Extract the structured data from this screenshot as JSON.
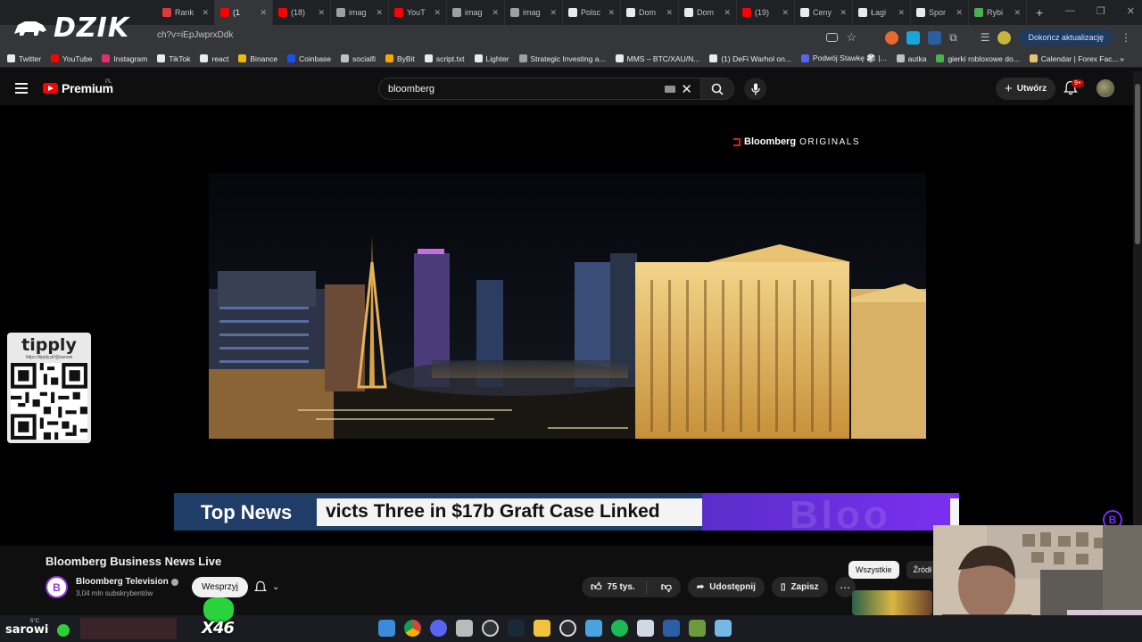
{
  "browser": {
    "tabs": [
      {
        "label": "Rank",
        "color": "#e03b3b"
      },
      {
        "label": "(1",
        "color": "#ff0000",
        "active": true
      },
      {
        "label": "(18)",
        "color": "#ff0000"
      },
      {
        "label": "imag",
        "color": "#9aa0a6"
      },
      {
        "label": "YouT",
        "color": "#ff0000"
      },
      {
        "label": "imag",
        "color": "#9aa0a6"
      },
      {
        "label": "imag",
        "color": "#9aa0a6"
      },
      {
        "label": "Polsc",
        "color": "#e8eaed"
      },
      {
        "label": "Dom",
        "color": "#e8eaed"
      },
      {
        "label": "Dom",
        "color": "#e8eaed"
      },
      {
        "label": "(19)",
        "color": "#ff0000"
      },
      {
        "label": "Ceny",
        "color": "#e8eaed"
      },
      {
        "label": "Łagi",
        "color": "#e8eaed"
      },
      {
        "label": "Spor",
        "color": "#e8eaed"
      },
      {
        "label": "Rybi",
        "color": "#4caf50"
      }
    ],
    "new_tab": "+",
    "url": "ch?v=iEpJwprxDdk",
    "update_button": "Dokończ aktualizację",
    "bookmarks": [
      {
        "label": "Twitter",
        "color": "#e8eaed"
      },
      {
        "label": "YouTube",
        "color": "#ff0000"
      },
      {
        "label": "Instagram",
        "color": "#e1306c"
      },
      {
        "label": "TikTok",
        "color": "#e8eaed"
      },
      {
        "label": "react",
        "color": "#e8eaed"
      },
      {
        "label": "Binance",
        "color": "#f0b90b"
      },
      {
        "label": "Coinbase",
        "color": "#1652f0"
      },
      {
        "label": "socialfi",
        "color": "#bdc1c6"
      },
      {
        "label": "ByBit",
        "color": "#f7a600"
      },
      {
        "label": "script.txt",
        "color": "#e8eaed"
      },
      {
        "label": "Lighter",
        "color": "#e8eaed"
      },
      {
        "label": "Strategic Investing a...",
        "color": "#9aa0a6"
      },
      {
        "label": "MMS – BTC/XAU/N...",
        "color": "#e8eaed"
      },
      {
        "label": "(1) DeFi Warhol on...",
        "color": "#e8eaed"
      },
      {
        "label": "Podwój Stawkę 🎲 |...",
        "color": "#5865f2"
      },
      {
        "label": "autka",
        "color": "#bdc1c6"
      },
      {
        "label": "gierki robloxowe do...",
        "color": "#4caf50"
      },
      {
        "label": "Calendar | Forex Fac...",
        "color": "#e8c170"
      }
    ],
    "bookmarks_more": "»"
  },
  "overlay": {
    "brand": "DZIK",
    "tipply_title": "tipply",
    "tipply_url": "https://tipply.pl/@sarowi",
    "streamer": "sarowi",
    "weather": "5°C",
    "multiplier": "X46"
  },
  "youtube": {
    "logo": "Premium",
    "region": "PL",
    "search_value": "bloomberg",
    "create_label": "Utwórz",
    "notif_badge": "9+",
    "video": {
      "watermark_brand": "Bloomberg",
      "watermark_sub": "ORIGINALS",
      "ticker_label": "Top News",
      "ticker_headline": "victs Three  in $17b Graft Case Linked",
      "ticker_ghost": "Bloo",
      "channel_corner_letter": "B"
    },
    "title": "Bloomberg Business News Live",
    "channel": {
      "name": "Bloomberg Television",
      "subscribers": "3,04 mln subskrybentów",
      "avatar_letter": "B",
      "support_label": "Wesprzyj"
    },
    "actions": {
      "likes": "75 tys.",
      "share": "Udostępnij",
      "save": "Zapisz",
      "more": "⋯"
    },
    "chips": [
      "Wszystkie",
      "Źródł"
    ]
  },
  "colors": {
    "accent_red": "#ff0000",
    "bloomberg_purple": "#7b2ff0",
    "ticker_blue": "#1f3d67"
  }
}
